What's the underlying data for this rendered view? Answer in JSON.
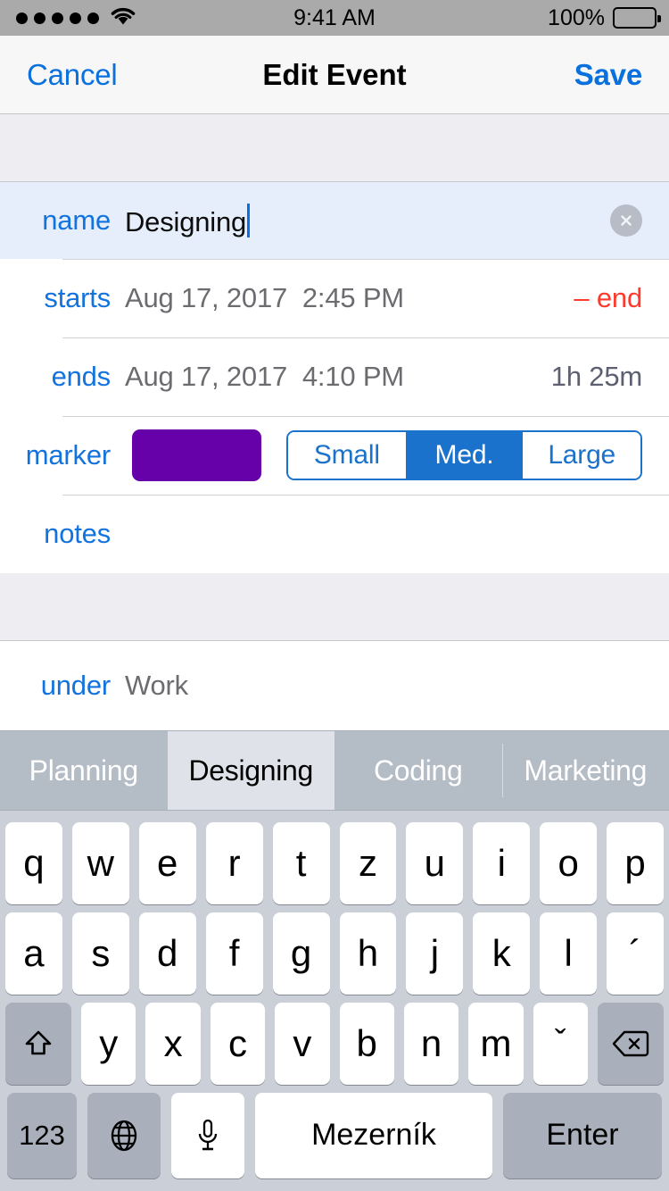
{
  "status_bar": {
    "signal_dots": 5,
    "wifi": "wifi-icon",
    "time": "9:41 AM",
    "battery_percent": "100%",
    "battery_level": 100
  },
  "nav_bar": {
    "cancel_label": "Cancel",
    "title": "Edit Event",
    "save_label": "Save"
  },
  "form": {
    "name": {
      "label": "name",
      "value": "Designing",
      "clear_icon": "clear-circle-icon"
    },
    "starts": {
      "label": "starts",
      "date": "Aug 17, 2017",
      "time": "2:45 PM",
      "trailing": "– end"
    },
    "ends": {
      "label": "ends",
      "date": "Aug 17, 2017",
      "time": "4:10 PM",
      "trailing": "1h 25m"
    },
    "marker": {
      "label": "marker",
      "color": "#6600a8",
      "sizes": [
        "Small",
        "Med.",
        "Large"
      ],
      "selected_size": "Med."
    },
    "notes": {
      "label": "notes",
      "value": ""
    },
    "under": {
      "label": "under",
      "value": "Work"
    }
  },
  "colors": {
    "accent_blue": "#1373de",
    "nav_blue": "#0a70dd",
    "segment_blue": "#1a72cc",
    "destructive_red": "#fc3b2e",
    "marker_purple": "#6600a8",
    "name_row_highlight": "#e6eefb"
  },
  "keyboard": {
    "suggestions": [
      "Planning",
      "Designing",
      "Coding",
      "Marketing"
    ],
    "active_suggestion": "Designing",
    "row1": [
      "q",
      "w",
      "e",
      "r",
      "t",
      "z",
      "u",
      "i",
      "o",
      "p"
    ],
    "row2": [
      "a",
      "s",
      "d",
      "f",
      "g",
      "h",
      "j",
      "k",
      "l",
      "´"
    ],
    "row3_letters": [
      "y",
      "x",
      "c",
      "v",
      "b",
      "n",
      "m"
    ],
    "row3_dead_key": "ˇ",
    "shift_icon": "shift-arrow-icon",
    "backspace_icon": "backspace-icon",
    "numbers_label": "123",
    "globe_icon": "globe-icon",
    "mic_icon": "microphone-icon",
    "space_label": "Mezerník",
    "enter_label": "Enter"
  }
}
